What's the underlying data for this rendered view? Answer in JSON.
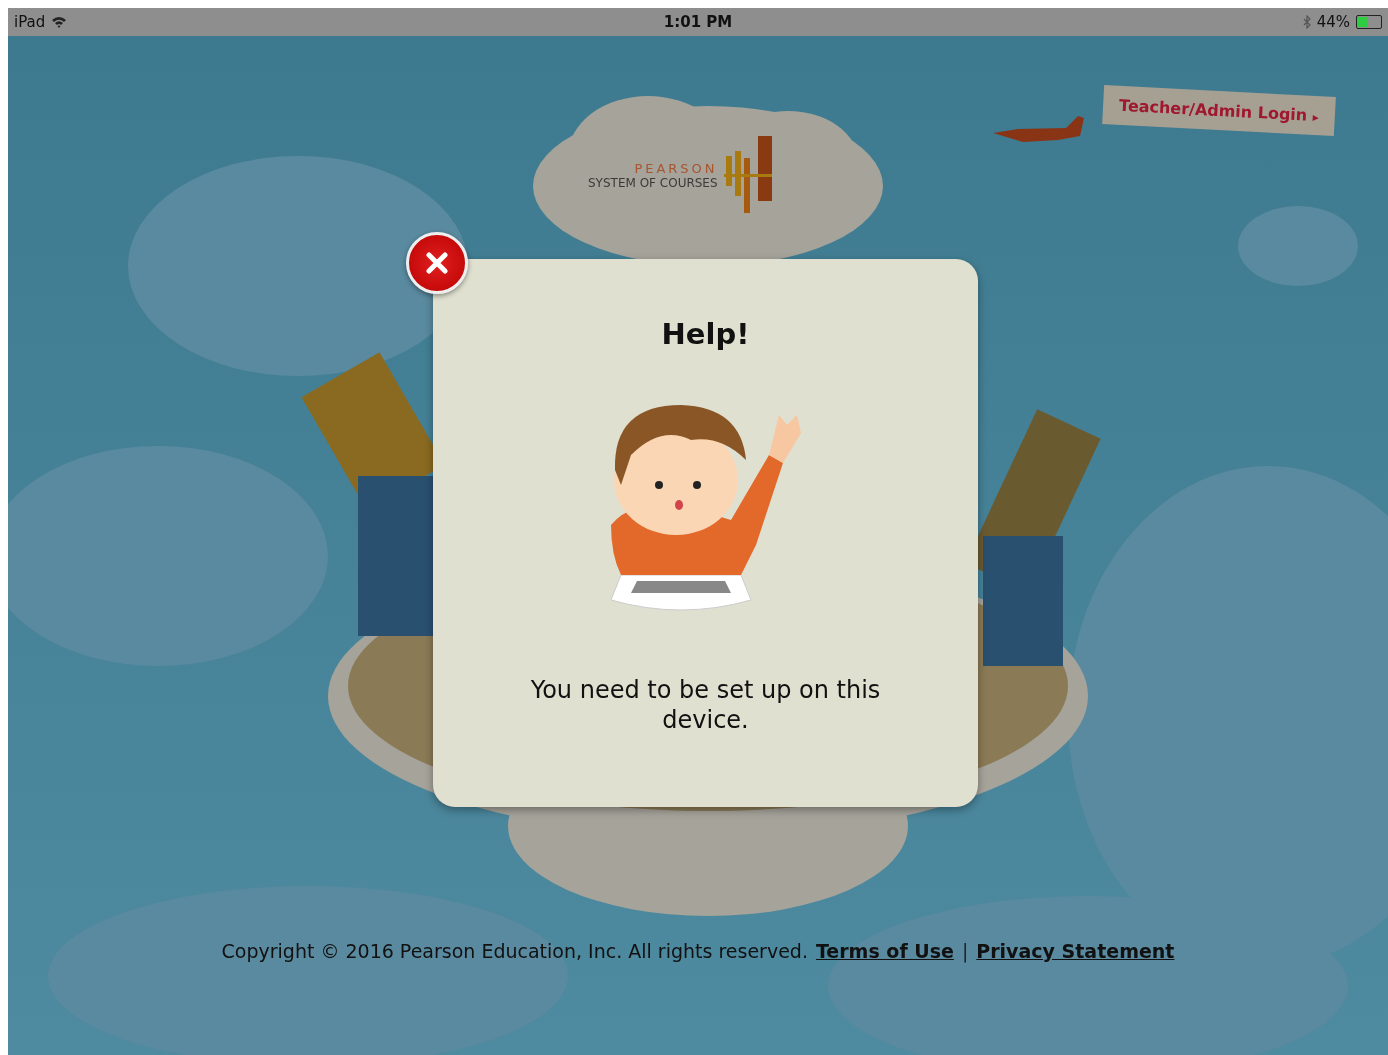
{
  "status_bar": {
    "device": "iPad",
    "time": "1:01 PM",
    "battery": {
      "reading": "44%",
      "level": 0.44
    }
  },
  "logo": {
    "brand": "PEARSON",
    "product": "SYSTEM OF COURSES"
  },
  "login_banner": {
    "label": "Teacher/Admin Login",
    "arrow": "▸"
  },
  "dialog": {
    "title": "Help!",
    "message": "You need to be set up on this device."
  },
  "footer": {
    "copyright": "Copyright © 2016 Pearson Education, Inc. All rights reserved.",
    "links": [
      "Terms of Use",
      "Privacy Statement"
    ],
    "separator": "|"
  }
}
